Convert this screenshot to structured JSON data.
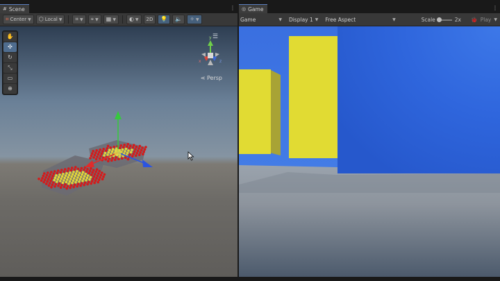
{
  "scene": {
    "tab_label": "Scene",
    "toolbar": {
      "pivot_label": "Center",
      "space_label": "Local",
      "mode_2d_label": "2D"
    },
    "tools": [
      {
        "name": "hand-tool",
        "glyph": "✋"
      },
      {
        "name": "move-tool",
        "glyph": "✣"
      },
      {
        "name": "rotate-tool",
        "glyph": "↻"
      },
      {
        "name": "scale-tool",
        "glyph": "⤡"
      },
      {
        "name": "rect-tool",
        "glyph": "▭"
      },
      {
        "name": "transform-tool",
        "glyph": "⊕"
      }
    ],
    "projection_label": "Persp",
    "orientation_gizmo": {
      "y": "y",
      "x": "x",
      "z": "z"
    }
  },
  "game": {
    "tab_label": "Game",
    "toolbar": {
      "view_label": "Game",
      "display_label": "Display 1",
      "aspect_label": "Free Aspect",
      "scale_label": "Scale",
      "scale_value": "2x",
      "play_label": "Play"
    }
  },
  "colors": {
    "accent_blue": "#2f66dd",
    "cube_yellow": "#e1db33",
    "particle_red": "#d61a1a"
  }
}
